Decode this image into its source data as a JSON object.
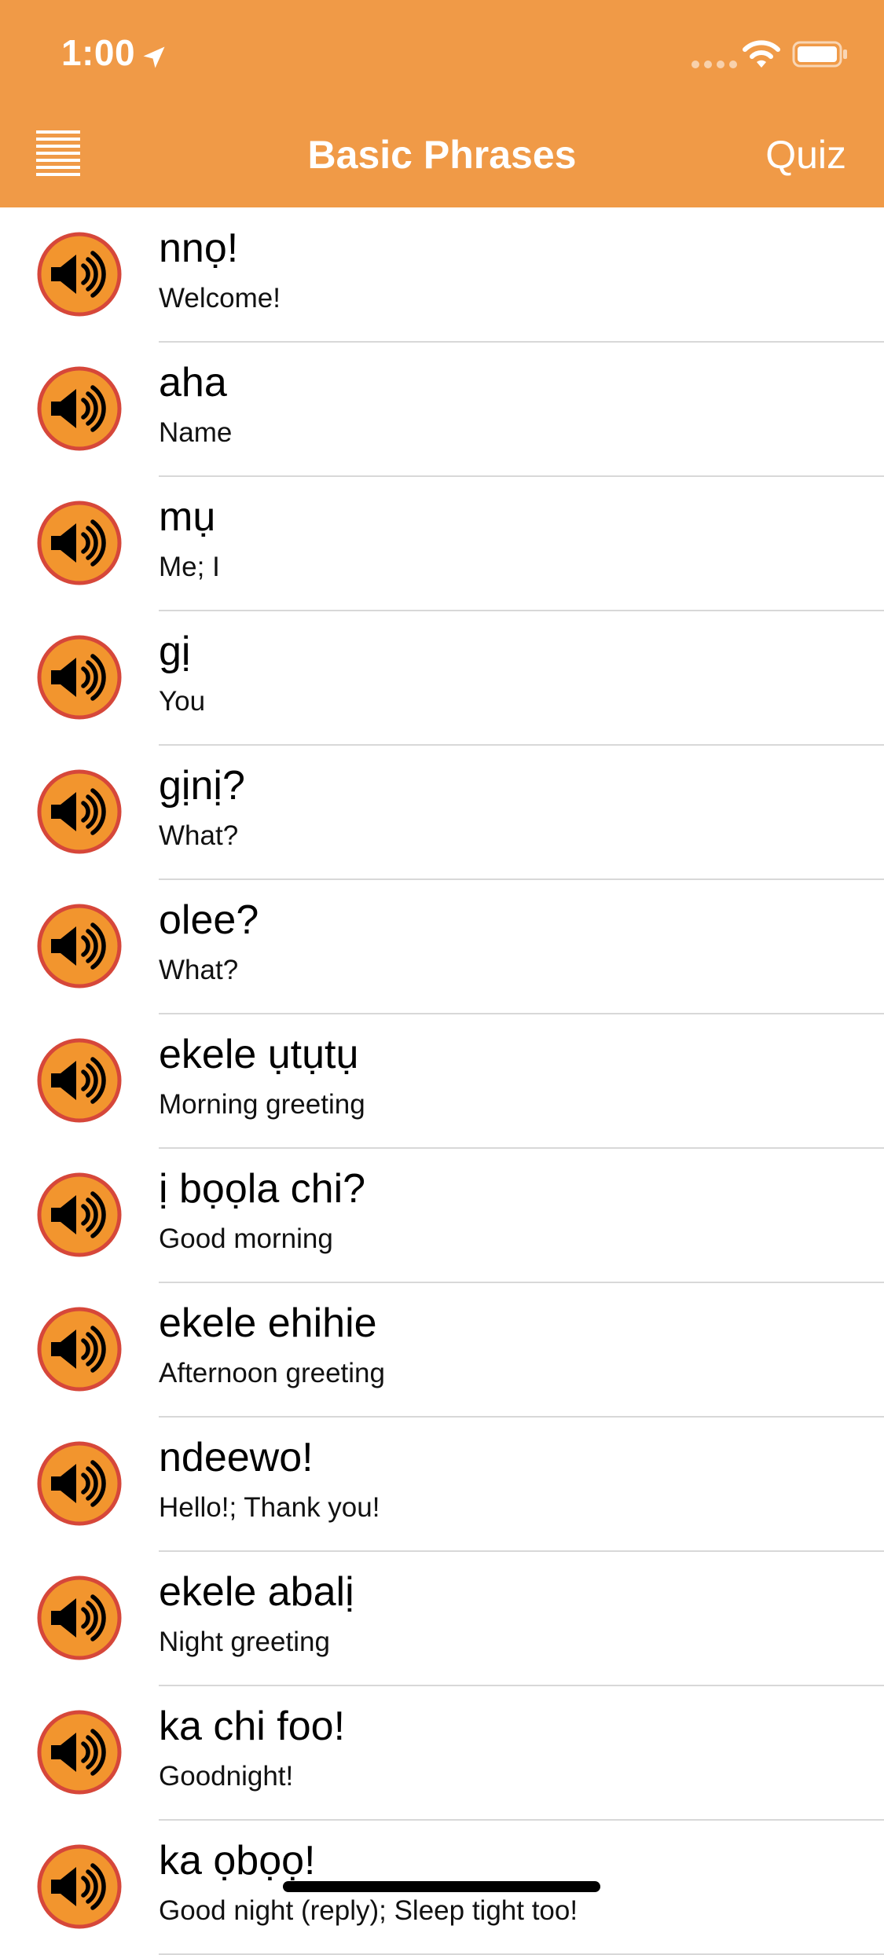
{
  "status_bar": {
    "time": "1:00"
  },
  "nav": {
    "title": "Basic Phrases",
    "quiz_label": "Quiz"
  },
  "colors": {
    "accent": "#F09A47",
    "speaker_fill": "#F2952E",
    "speaker_ring": "#D6473A"
  },
  "phrases": [
    {
      "igbo": "nnọ!",
      "english": "Welcome!"
    },
    {
      "igbo": "aha",
      "english": "Name"
    },
    {
      "igbo": "mụ",
      "english": "Me; I"
    },
    {
      "igbo": "gị",
      "english": "You"
    },
    {
      "igbo": "gịnị?",
      "english": "What?"
    },
    {
      "igbo": "olee?",
      "english": "What?"
    },
    {
      "igbo": "ekele ụtụtụ",
      "english": "Morning greeting"
    },
    {
      "igbo": "ị bọọla chi?",
      "english": "Good morning"
    },
    {
      "igbo": "ekele ehihie",
      "english": "Afternoon greeting"
    },
    {
      "igbo": "ndeewo!",
      "english": "Hello!; Thank you!"
    },
    {
      "igbo": "ekele abalị",
      "english": "Night greeting"
    },
    {
      "igbo": "ka chi foo!",
      "english": "Goodnight!"
    },
    {
      "igbo": "ka ọbọọ!",
      "english": "Good night (reply); Sleep tight too!"
    }
  ]
}
